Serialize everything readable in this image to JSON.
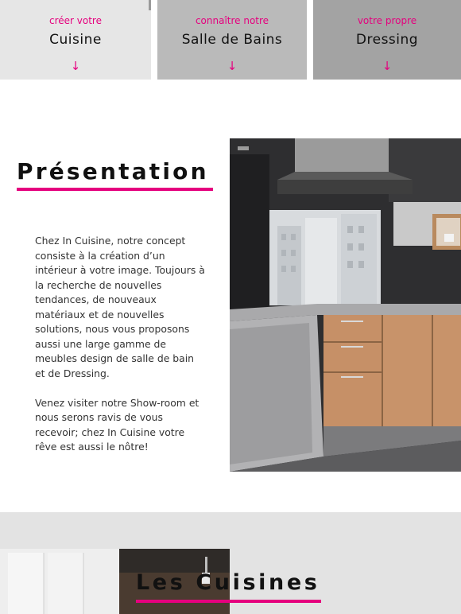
{
  "tiles": [
    {
      "kicker": "créer votre",
      "title": "Cuisine",
      "arrow": "↓"
    },
    {
      "kicker": "connaître notre",
      "title": "Salle de Bains",
      "arrow": "↓"
    },
    {
      "kicker": "votre propre",
      "title": "Dressing",
      "arrow": "↓"
    }
  ],
  "presentation": {
    "title": "Présentation",
    "paragraphs": [
      "Chez In Cuisine, notre concept consiste à la création d’un intérieur à votre image. Toujours à la recherche de nouvelles tendances, de nouveaux matériaux et de nouvelles solutions, nous vous proposons aussi une large gamme de meubles design de salle de bain et de Dressing.",
      "Venez visiter notre Show-room et nous serons ravis de vous recevoir; chez In Cuisine votre rêve est aussi le nôtre!"
    ]
  },
  "cuisines": {
    "title": "Les Cuisines"
  },
  "colors": {
    "accent": "#e5007e"
  }
}
